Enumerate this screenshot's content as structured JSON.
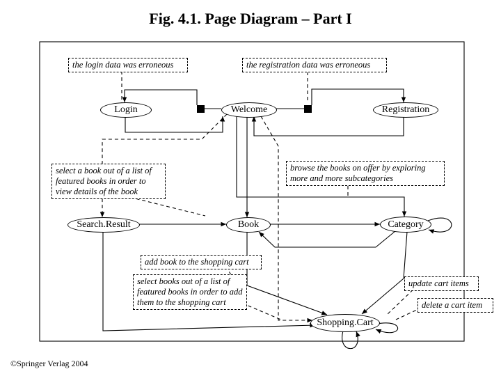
{
  "title": "Fig. 4.1. Page Diagram – Part I",
  "nodes": {
    "login": "Login",
    "welcome": "Welcome",
    "registration": "Registration",
    "searchResult": "Search.Result",
    "book": "Book",
    "category": "Category",
    "shoppingCart": "Shopping.Cart"
  },
  "notes": {
    "loginErr": "the login data was erroneous",
    "regErr": "the registration data was erroneous",
    "selectFeaturedDetails": "select a book out of a list of featured books in order to view details of the book",
    "browseSub": "browse the books on offer by exploring more and more subcategories",
    "addBook": "add book to the shopping cart",
    "selectFeaturedAdd": "select books out of a list of featured books in order to add them to the shopping cart",
    "updateCart": "update cart items",
    "deleteCart": "delete a cart item"
  },
  "copyright": "©Springer Verlag 2004"
}
